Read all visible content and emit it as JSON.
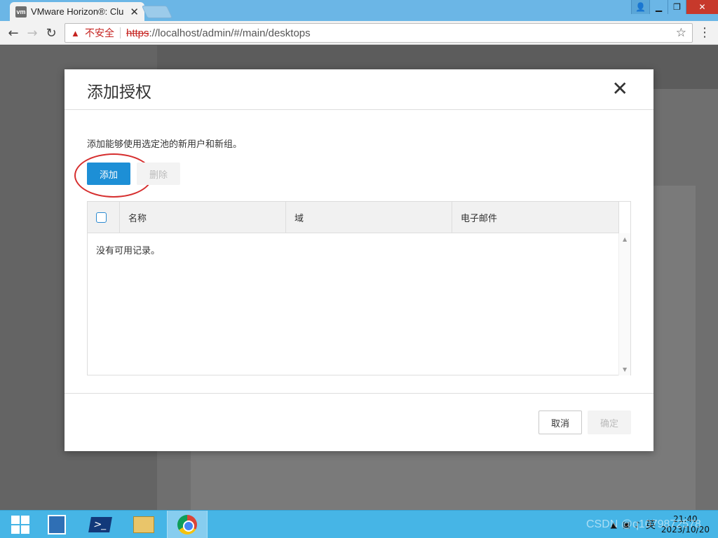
{
  "browser": {
    "tab_title": "VMware Horizon®: Clu",
    "tab_favicon": "vm",
    "security_label": "不安全",
    "url_scheme": "https",
    "url_rest": "://localhost/admin/#/main/desktops"
  },
  "dialog": {
    "title": "添加授权",
    "description": "添加能够使用选定池的新用户和新组。",
    "add_label": "添加",
    "remove_label": "删除",
    "columns": [
      "名称",
      "域",
      "电子邮件"
    ],
    "empty_text": "没有可用记录。",
    "cancel_label": "取消",
    "ok_label": "确定"
  },
  "taskbar": {
    "time": "21:40",
    "date": "2023/10/20",
    "ime": "英",
    "watermark": "CSDN @q1079872578"
  },
  "colors": {
    "primary": "#1d8fd6",
    "annotation": "#d62f2f",
    "taskbar": "#46b5e6"
  }
}
